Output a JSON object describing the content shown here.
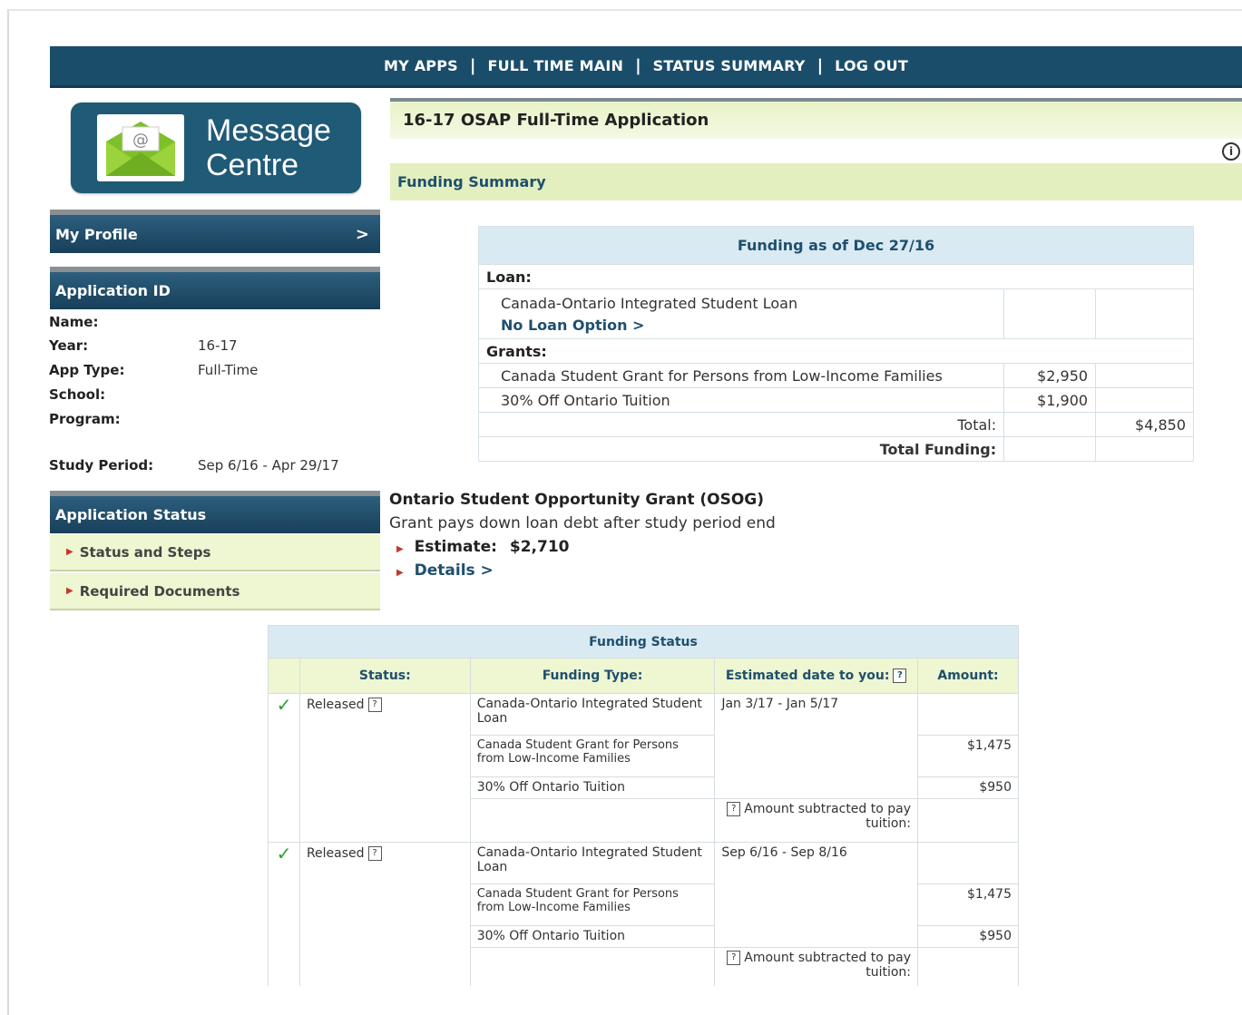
{
  "topnav": {
    "items": [
      "MY APPS",
      "FULL TIME MAIN",
      "STATUS SUMMARY",
      "LOG OUT"
    ]
  },
  "message_centre": {
    "line1": "Message",
    "line2": "Centre",
    "icon": "envelope-at-icon"
  },
  "profile": {
    "label": "My Profile",
    "chevron": ">"
  },
  "application": {
    "header": "Application ID",
    "fields": [
      {
        "label": "Name:",
        "value": ""
      },
      {
        "label": "Year:",
        "value": "16-17"
      },
      {
        "label": "App Type:",
        "value": "Full-Time"
      },
      {
        "label": "School:",
        "value": ""
      },
      {
        "label": "Program:",
        "value": ""
      }
    ],
    "study_period_label": "Study Period:",
    "study_period_value": "Sep 6/16 - Apr 29/17"
  },
  "app_status": {
    "header": "Application Status",
    "items": [
      "Status and Steps",
      "Required Documents"
    ]
  },
  "main": {
    "title": "16-17 OSAP Full-Time Application",
    "section": "Funding Summary",
    "info_glyph": "i"
  },
  "funding_asof": {
    "heading": "Funding as of Dec 27/16",
    "loan_label": "Loan:",
    "loan_item": "Canada-Ontario Integrated Student Loan",
    "loan_link": "No Loan Option >",
    "grants_label": "Grants:",
    "grants": [
      {
        "name": "Canada Student Grant for Persons from Low-Income Families",
        "amount": "$2,950"
      },
      {
        "name": "30% Off Ontario Tuition",
        "amount": "$1,900"
      }
    ],
    "total_label": "Total:",
    "total_value": "$4,850",
    "total_funding_label": "Total Funding:"
  },
  "osog": {
    "title": "Ontario Student Opportunity Grant (OSOG)",
    "desc": "Grant pays down loan debt after study period end",
    "estimate_label": "Estimate:",
    "estimate_value": "$2,710",
    "details_link": "Details >"
  },
  "funding_status": {
    "heading": "Funding Status",
    "columns": [
      "Status:",
      "Funding Type:",
      "Estimated date to you:",
      "Amount:"
    ],
    "help_glyph": "?",
    "check": "✓",
    "groups": [
      {
        "status": "Released",
        "date": "Jan 3/17 - Jan 5/17",
        "rows": [
          {
            "type": "Canada-Ontario Integrated Student Loan",
            "amount": ""
          },
          {
            "type": "Canada Student Grant for Persons from Low-Income Families",
            "amount": "$1,475"
          },
          {
            "type": "30% Off Ontario Tuition",
            "amount": "$950"
          }
        ],
        "note": "Amount subtracted to pay tuition:"
      },
      {
        "status": "Released",
        "date": "Sep 6/16 - Sep 8/16",
        "rows": [
          {
            "type": "Canada-Ontario Integrated Student Loan",
            "amount": ""
          },
          {
            "type": "Canada Student Grant for Persons from Low-Income Families",
            "amount": "$1,475"
          },
          {
            "type": "30% Off Ontario Tuition",
            "amount": "$950"
          }
        ],
        "note": "Amount subtracted to pay tuition:"
      }
    ]
  },
  "colors": {
    "nav": "#1a4d6a",
    "accent_green": "#e3efbf",
    "link": "#1f4f6e",
    "check": "#2e9e2e"
  }
}
